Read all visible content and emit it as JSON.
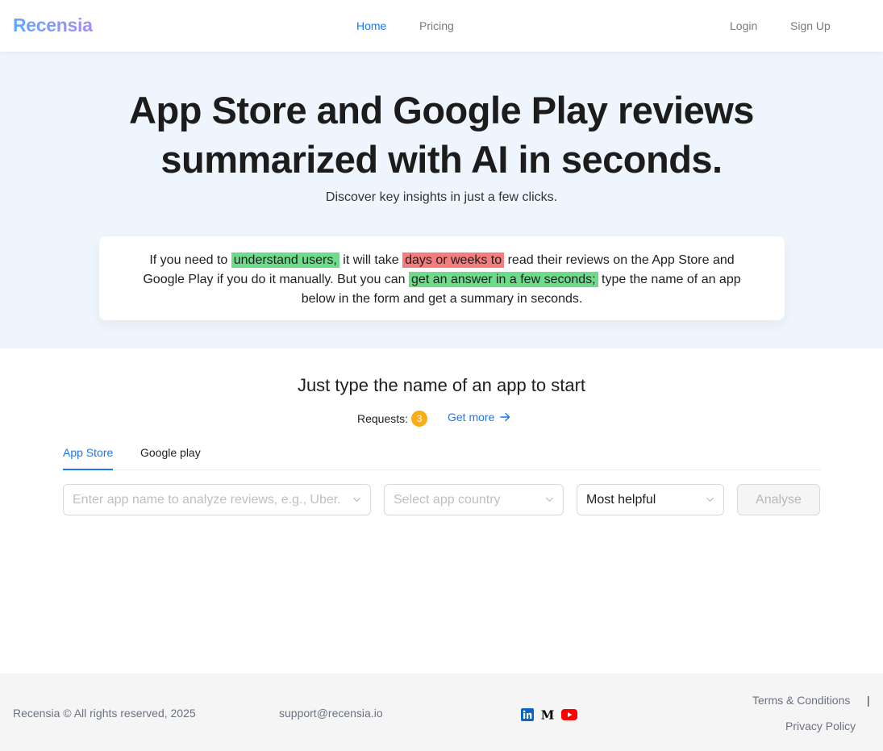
{
  "header": {
    "logo": "Recensia",
    "nav": {
      "home": "Home",
      "pricing": "Pricing",
      "login": "Login",
      "signup": "Sign Up"
    }
  },
  "hero": {
    "title_line1": "App Store and Google Play reviews",
    "title_line2": "summarized with AI in seconds.",
    "subtitle": "Discover key insights in just a few clicks.",
    "card": {
      "t1": "If you need to ",
      "h1": "understand users,",
      "t2": " it will take ",
      "h2": "days or weeks to",
      "t3": " read their reviews on the App Store and Google Play if you do it manually. But you can ",
      "h3": "get an answer in a few seconds;",
      "t4": " type the name of an app below in the form and get a summary in seconds."
    }
  },
  "main": {
    "title": "Just type the name of an app to start",
    "requests_label": "Requests:",
    "requests_count": "3",
    "get_more": "Get more",
    "tabs": [
      "App Store",
      "Google play"
    ],
    "app_placeholder": "Enter app name to analyze reviews, e.g., Uber.",
    "country_placeholder": "Select app country",
    "sort_value": "Most helpful",
    "analyse": "Analyse"
  },
  "footer": {
    "copyright": "Recensia © All rights reserved, 2025",
    "email": "support@recensia.io",
    "terms": "Terms & Conditions",
    "separator": "|",
    "privacy": "Privacy Policy",
    "social_icons": [
      "linkedin-icon",
      "medium-icon",
      "youtube-icon"
    ],
    "medium_glyph": "M"
  },
  "colors": {
    "accent": "#1677ff",
    "hero_bg": "#eef5fd",
    "highlight_green": "#6ddb8a",
    "highlight_red": "#f47c7c",
    "badge": "#faad14"
  }
}
